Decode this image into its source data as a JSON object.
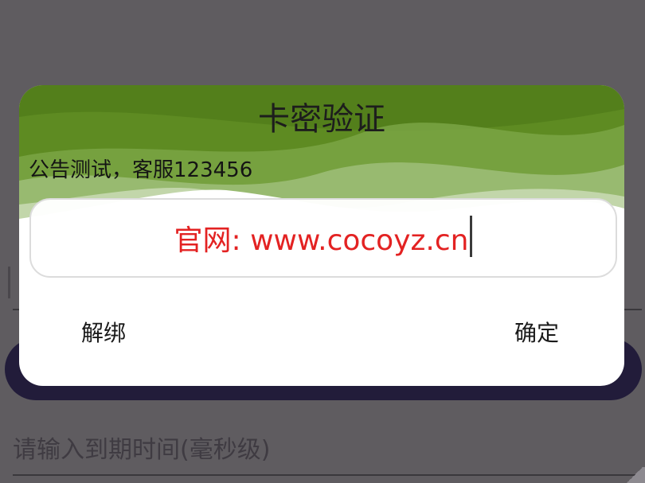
{
  "dialog": {
    "title": "卡密验证",
    "notice": "公告测试，客服123456",
    "input": {
      "value": "官网: www.cocoyz.cn"
    },
    "buttons": {
      "unbind_label": "解绑",
      "confirm_label": "确定"
    }
  },
  "background": {
    "expiry_placeholder": "请输入到期时间(毫秒级)"
  },
  "colors": {
    "overlay": "#5f5c60",
    "header_green": "#6f9a34",
    "input_text": "#e32222",
    "bg_button": "#221c3a"
  }
}
